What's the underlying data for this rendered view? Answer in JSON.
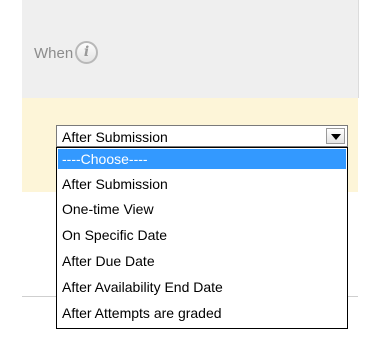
{
  "field": {
    "label": "When",
    "info_icon": "info-icon",
    "info_glyph": "i"
  },
  "select": {
    "value": "After Submission",
    "arrow_icon": "chevron-down-icon",
    "options": [
      "----Choose----",
      "After Submission",
      "One-time View",
      "On Specific Date",
      "After Due Date",
      "After Availability End Date",
      "After Attempts are graded"
    ],
    "highlighted_index": 0
  },
  "colors": {
    "highlight": "#3399ff",
    "header_band": "#efefef",
    "yellow_band": "#fdf5d8"
  }
}
